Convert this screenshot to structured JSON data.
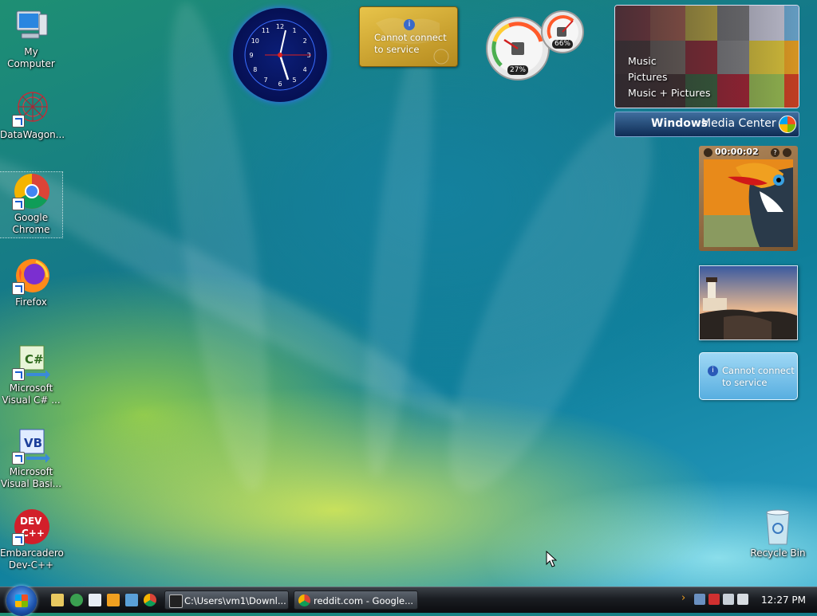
{
  "desktop": {
    "icons": [
      {
        "label": "My Computer"
      },
      {
        "label": "DataWagon..."
      },
      {
        "label": "Google Chrome"
      },
      {
        "label": "Firefox"
      },
      {
        "label": "Microsoft Visual C# ..."
      },
      {
        "label": "Microsoft Visual Basi..."
      },
      {
        "label": "Embarcadero Dev-C++"
      },
      {
        "label": "Recycle Bin"
      }
    ]
  },
  "gadgets": {
    "clock": {
      "numerals": [
        "12",
        "1",
        "2",
        "3",
        "4",
        "5",
        "6",
        "7",
        "8",
        "9",
        "10",
        "11"
      ]
    },
    "feed_gold": {
      "message": "Cannot connect to service"
    },
    "cpu_meter": {
      "cpu": "27%",
      "memory": "66%"
    },
    "media_center": {
      "menu": [
        "Music",
        "Pictures",
        "Music + Pictures"
      ],
      "brand_a": "Windows",
      "brand_b": "Media Center"
    },
    "slideshow": {
      "timer": "00:00:02"
    },
    "feed_blue": {
      "message": "Cannot connect to service"
    }
  },
  "taskbar": {
    "tasks": [
      {
        "label": "C:\\Users\\vm1\\Downl..."
      },
      {
        "label": "reddit.com - Google..."
      }
    ],
    "time": "12:27 PM"
  },
  "colors": {
    "taskbar": "#1a1d22",
    "accent_blue": "#1a4fa8",
    "gold": "#d4aa32"
  }
}
